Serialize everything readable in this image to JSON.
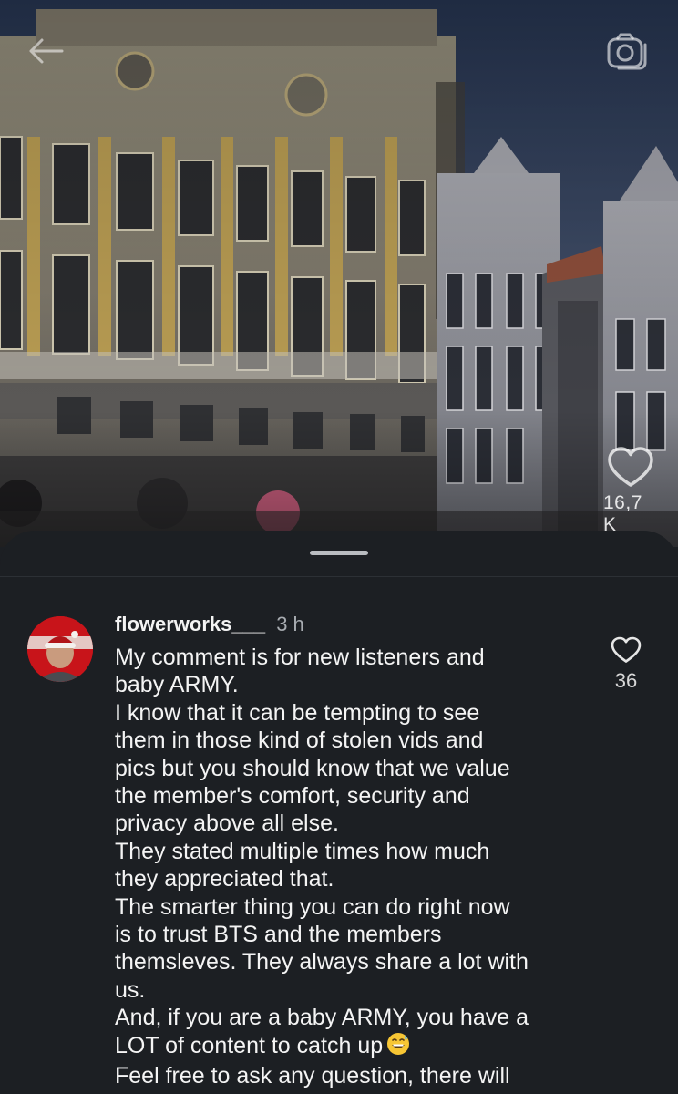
{
  "post": {
    "like_count": "16,7 K"
  },
  "comment": {
    "username": "flowerworks___",
    "time": "3 h",
    "like_count": "36",
    "lines": [
      "My comment is for new listeners and",
      "baby ARMY.",
      "I know that it can be tempting to see",
      "them in those kind of stolen vids and",
      "pics but you should know that we value",
      "the member's comfort, security and",
      "privacy above all else.",
      "They stated multiple times how much",
      "they appreciated that.",
      "The smarter thing you can do right now",
      "is to trust BTS and the members",
      "themsleves. They always share a lot with",
      "us.",
      "And, if you are a baby ARMY, you have a",
      "LOT of content to catch up",
      "Feel free to ask any question, there will"
    ]
  },
  "icons": {
    "back": "arrow-left-icon",
    "camera": "camera-icon",
    "post_like": "heart-icon",
    "comment_like": "heart-outline-icon",
    "emoji": "grinning-face-with-sweat-emoji"
  }
}
